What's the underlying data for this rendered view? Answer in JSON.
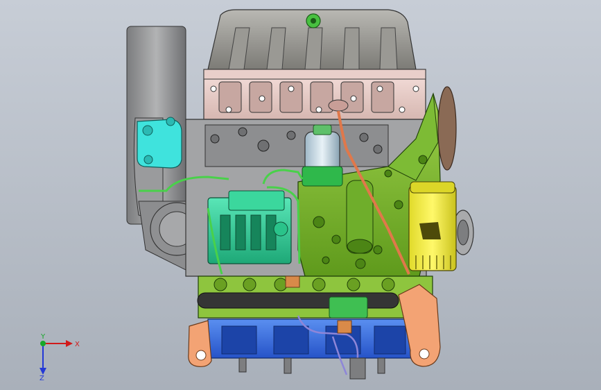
{
  "viewport": {
    "background_top": "#c7cdd6",
    "background_bottom": "#a9b0ba"
  },
  "model": {
    "label_on_filter": "ⵙ ||||| "
  },
  "triad": {
    "x_label": "X",
    "y_label": "Y",
    "z_label": "Z",
    "x_color": "#d11a1a",
    "y_color": "#18a82a",
    "z_color": "#2338d6"
  }
}
